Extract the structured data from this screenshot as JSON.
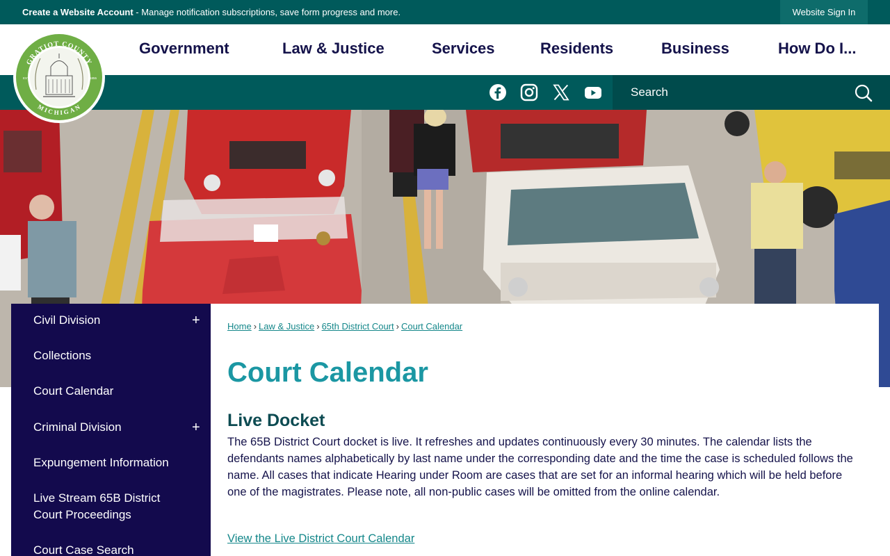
{
  "topbar": {
    "create_account_label": "Create a Website Account",
    "notice_text": " - Manage notification subscriptions, save form progress and more.",
    "signin_label": "Website Sign In"
  },
  "nav": {
    "items": [
      "Government",
      "Law & Justice",
      "Services",
      "Residents",
      "Business",
      "How Do I..."
    ]
  },
  "logo": {
    "top_text": "GRATIOT COUNTY",
    "bottom_text": "MICHIGAN",
    "est_left": "EST",
    "est_right": "1855"
  },
  "social": {
    "icons": [
      "facebook-icon",
      "instagram-icon",
      "x-icon",
      "youtube-icon"
    ]
  },
  "search": {
    "placeholder": "Search"
  },
  "sidebar": {
    "items": [
      {
        "label": "Civil Division",
        "expand": "+"
      },
      {
        "label": "Collections",
        "expand": ""
      },
      {
        "label": "Court Calendar",
        "expand": ""
      },
      {
        "label": "Criminal Division",
        "expand": "+"
      },
      {
        "label": "Expungement Information",
        "expand": ""
      },
      {
        "label": "Live Stream 65B District Court Proceedings",
        "expand": ""
      },
      {
        "label": "Court Case Search",
        "expand": ""
      }
    ]
  },
  "breadcrumb": {
    "items": [
      "Home",
      "Law & Justice",
      "65th District Court",
      "Court Calendar"
    ],
    "separator": "›"
  },
  "main": {
    "title": "Court Calendar",
    "section_title": "Live Docket",
    "body": "The 65B District Court docket is live. It refreshes and updates continuously every 30 minutes. The calendar lists the defendants names alphabetically by last name under the corresponding date and the time the case is scheduled follows the name. All cases that indicate Hearing under Room are cases that are set for an informal hearing which will be held before one of the magistrates. Please note, all non-public cases will be omitted from the online calendar.",
    "link_label": "View the Live District Court Calendar"
  },
  "colors": {
    "teal_dark": "#005a5b",
    "navy": "#130a4d",
    "title_teal": "#1b97a3",
    "link_teal": "#14878a"
  }
}
